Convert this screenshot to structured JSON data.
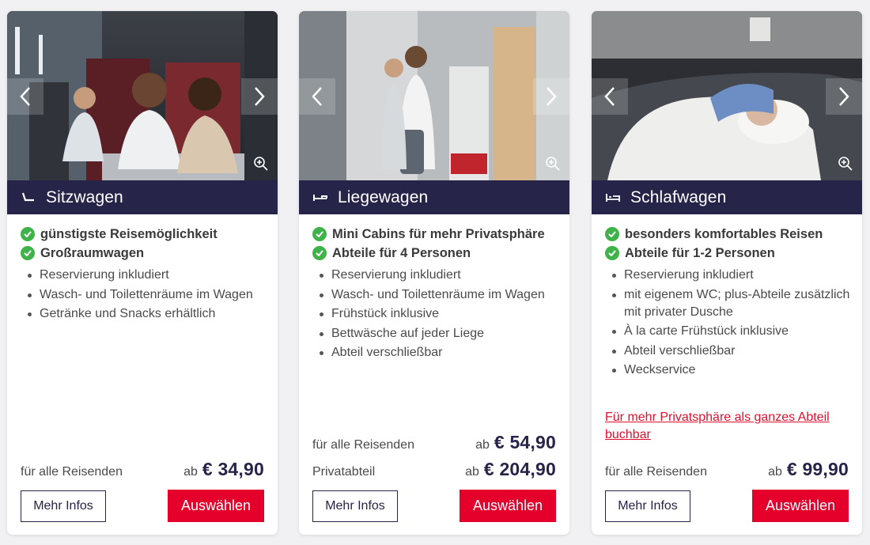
{
  "cards": [
    {
      "title": "Sitzwagen",
      "title_icon": "seat-icon",
      "checks": [
        "günstigste Reisemöglichkeit",
        "Großraumwagen"
      ],
      "bullets": [
        "Reservierung inkludiert",
        "Wasch- und Toilettenräume im Wagen",
        "Getränke und Snacks erhältlich"
      ],
      "link": "",
      "prices": [
        {
          "label": "für alle Reisenden",
          "prefix": "ab",
          "amount": "€ 34,90"
        }
      ],
      "info_label": "Mehr Infos",
      "select_label": "Auswählen"
    },
    {
      "title": "Liegewagen",
      "title_icon": "couchette-icon",
      "checks": [
        "Mini Cabins für mehr Privatsphäre",
        "Abteile für 4 Personen"
      ],
      "bullets": [
        "Reservierung inkludiert",
        "Wasch- und Toilettenräume im Wagen",
        "Frühstück inklusive",
        "Bettwäsche auf jeder Liege",
        "Abteil verschließbar"
      ],
      "link": "",
      "prices": [
        {
          "label": "für alle Reisenden",
          "prefix": "ab",
          "amount": "€ 54,90"
        },
        {
          "label": "Privatabteil",
          "prefix": "ab",
          "amount": "€ 204,90"
        }
      ],
      "info_label": "Mehr Infos",
      "select_label": "Auswählen"
    },
    {
      "title": "Schlafwagen",
      "title_icon": "bed-icon",
      "checks": [
        "besonders komfortables Reisen",
        "Abteile für 1-2 Personen"
      ],
      "bullets": [
        "Reservierung inkludiert",
        "mit eigenem WC; plus-Abteile zusätzlich mit privater Dusche",
        "À la carte Frühstück inklusive",
        "Abteil verschließbar",
        "Weckservice"
      ],
      "link": "Für mehr Privatsphäre als ganzes Abteil buchbar",
      "prices": [
        {
          "label": "für alle Reisenden",
          "prefix": "ab",
          "amount": "€ 99,90"
        }
      ],
      "info_label": "Mehr Infos",
      "select_label": "Auswählen"
    }
  ],
  "colors": {
    "header_bg": "#262448",
    "check_green": "#3fb349",
    "button_red": "#e4002b",
    "link_red": "#e0102d"
  }
}
